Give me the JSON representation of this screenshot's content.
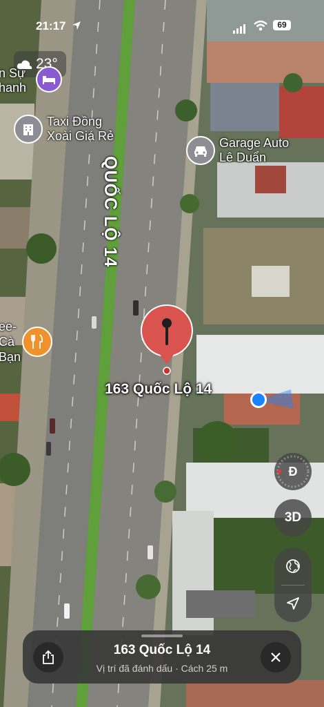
{
  "status_bar": {
    "time": "21:17",
    "battery": "69"
  },
  "weather": {
    "temperature": "23°",
    "icon": "cloud-moon-icon"
  },
  "map": {
    "road_label": "QUỐC LỘ 14",
    "pois": [
      {
        "name": "Taxi Đồng Xoài Giá Rẻ",
        "line1": "Taxi Đồng",
        "line2": "Xoài Giá Rẻ",
        "icon": "building-icon"
      },
      {
        "name": "Garage Auto Lê Duẩn",
        "line1": "Garage Auto",
        "line2": "Lê Duẩn",
        "icon": "car-icon"
      }
    ],
    "partial_labels": {
      "top_left_1": "n Sự",
      "top_left_2": "hanh",
      "left_1": "ee-",
      "left_2": "Cà",
      "left_3": "Bạn"
    },
    "pin_label": "163 Quốc Lộ 14"
  },
  "controls": {
    "compass_label": "Đ",
    "view_3d_label": "3D"
  },
  "sheet": {
    "title": "163 Quốc Lộ 14",
    "subtitle": "Vị trí đã đánh dấu · Cách 25 m"
  },
  "colors": {
    "pin": "#d9534f",
    "user_location": "#1a84ff",
    "median": "#5fa03a"
  }
}
